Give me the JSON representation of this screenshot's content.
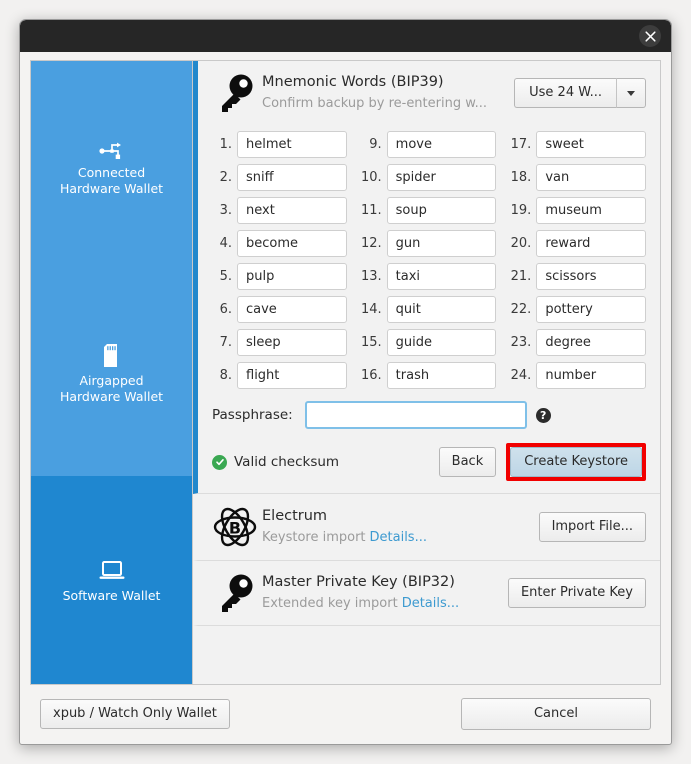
{
  "window": {
    "close_label": "Close",
    "close_icon": "close-icon"
  },
  "sidebar": {
    "items": [
      {
        "label_line1": "Connected",
        "label_line2": "Hardware Wallet",
        "icon": "usb-icon",
        "selected": false
      },
      {
        "label_line1": "Airgapped",
        "label_line2": "Hardware Wallet",
        "icon": "sdcard-icon",
        "selected": false
      },
      {
        "label_line1": "Software Wallet",
        "label_line2": "",
        "icon": "laptop-icon",
        "selected": true
      }
    ]
  },
  "sections": {
    "mnemonic": {
      "title": "Mnemonic Words (BIP39)",
      "subtitle": "Confirm backup by re-entering w...",
      "icon": "key-icon",
      "word_count_button": "Use 24 W...",
      "word_count_caret": "chevron-down-icon",
      "numbers": [
        "1.",
        "2.",
        "3.",
        "4.",
        "5.",
        "6.",
        "7.",
        "8.",
        "9.",
        "10.",
        "11.",
        "12.",
        "13.",
        "14.",
        "15.",
        "16.",
        "17.",
        "18.",
        "19.",
        "20.",
        "21.",
        "22.",
        "23.",
        "24."
      ],
      "words": [
        "helmet",
        "sniff",
        "next",
        "become",
        "pulp",
        "cave",
        "sleep",
        "flight",
        "move",
        "spider",
        "soup",
        "gun",
        "taxi",
        "quit",
        "guide",
        "trash",
        "sweet",
        "van",
        "museum",
        "reward",
        "scissors",
        "pottery",
        "degree",
        "number"
      ],
      "passphrase_label": "Passphrase:",
      "passphrase_value": "",
      "passphrase_placeholder": "",
      "help_glyph": "?",
      "checksum_text": "Valid checksum",
      "back_button": "Back",
      "create_button": "Create Keystore",
      "highlight_color": "#f10000"
    },
    "electrum": {
      "title": "Electrum",
      "subtitle": "Keystore import",
      "details_link": "Details...",
      "icon": "electrum-atom-icon",
      "action_button": "Import File..."
    },
    "masterkey": {
      "title": "Master Private Key (BIP32)",
      "subtitle": "Extended key import",
      "details_link": "Details...",
      "icon": "key-icon",
      "action_button": "Enter Private Key"
    }
  },
  "footer": {
    "xpub_button": "xpub / Watch Only Wallet",
    "cancel_button": "Cancel"
  },
  "colors": {
    "sidebar": "#4a9fe0",
    "sidebar_selected": "#1f87d0",
    "accent_bar": "#2288cc",
    "link": "#3d9ad0",
    "success": "#3aa852",
    "highlight": "#f10000"
  }
}
